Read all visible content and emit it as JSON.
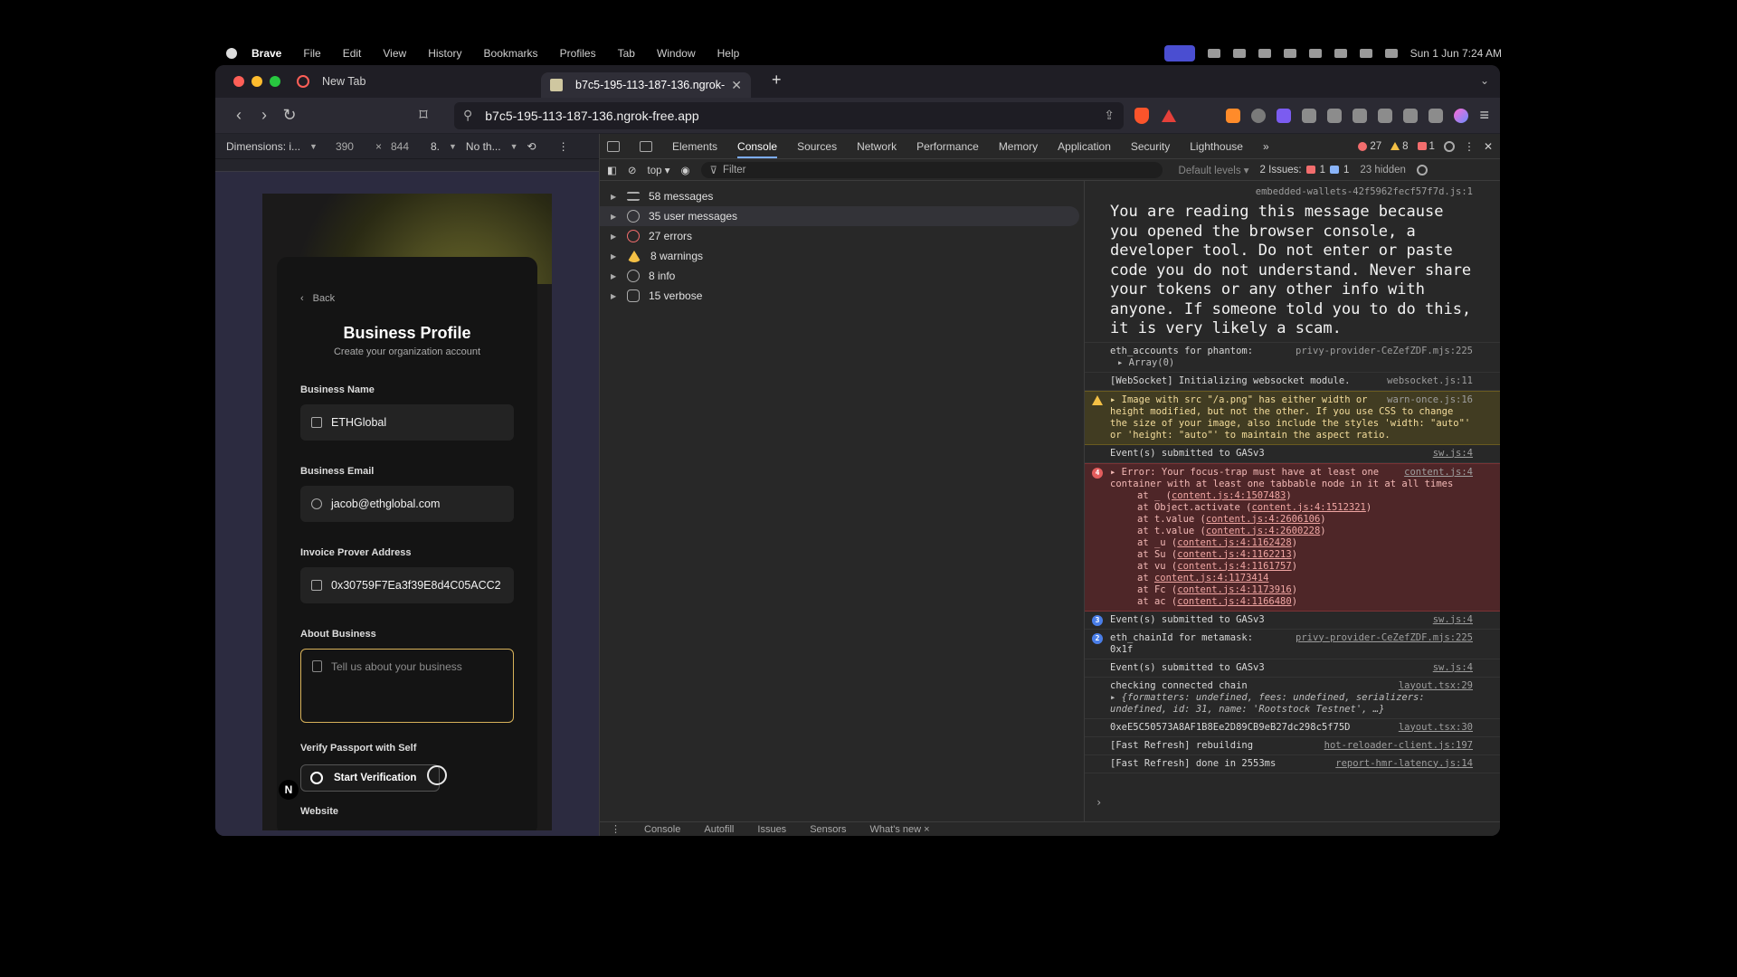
{
  "menubar": {
    "app": "Brave",
    "items": [
      "File",
      "Edit",
      "View",
      "History",
      "Bookmarks",
      "Profiles",
      "Tab",
      "Window",
      "Help"
    ],
    "clock": "Sun 1 Jun 7:24 AM"
  },
  "browser": {
    "tabs": [
      {
        "title": "New Tab"
      },
      {
        "title": "b7c5-195-113-187-136.ngrok-"
      }
    ],
    "url": "b7c5-195-113-187-136.ngrok-free.app"
  },
  "device_toolbar": {
    "dimensions_label": "Dimensions: i...",
    "width": "390",
    "times": "×",
    "height": "844",
    "zoom": "8.",
    "throttle": "No th..."
  },
  "app": {
    "back_label": "Back",
    "title": "Business Profile",
    "subtitle": "Create your organization account",
    "fields": {
      "business_name": {
        "label": "Business Name",
        "value": "ETHGlobal"
      },
      "business_email": {
        "label": "Business Email",
        "value": "jacob@ethglobal.com"
      },
      "prover_address": {
        "label": "Invoice Prover Address",
        "value": "0x30759F7Ea3f39E8d4C05ACC2"
      },
      "about": {
        "label": "About Business",
        "placeholder": "Tell us about your business"
      }
    },
    "verify_label": "Verify Passport with Self",
    "verify_button": "Start Verification",
    "website_label": "Website",
    "fab_label": "N"
  },
  "devtools": {
    "tabs": [
      "Elements",
      "Console",
      "Sources",
      "Network",
      "Performance",
      "Memory",
      "Application",
      "Security",
      "Lighthouse"
    ],
    "active_tab": "Console",
    "more_tabs": "»",
    "counts": {
      "errors": "27",
      "warnings": "8",
      "issues": "1"
    },
    "filterbar": {
      "context": "top",
      "filter_placeholder": "Filter",
      "levels": "Default levels",
      "issues_label": "2 Issues:",
      "issues_err": "1",
      "issues_info": "1",
      "hidden": "23 hidden"
    },
    "sidebar": [
      {
        "label": "58 messages",
        "icon": "list-icon"
      },
      {
        "label": "35 user messages",
        "icon": "user-icon"
      },
      {
        "label": "27 errors",
        "icon": "error-icon"
      },
      {
        "label": "8 warnings",
        "icon": "warning-icon"
      },
      {
        "label": "8 info",
        "icon": "info-icon"
      },
      {
        "label": "15 verbose",
        "icon": "bug-icon"
      }
    ],
    "console": {
      "msg0_src": "embedded-wallets-42f5962fecf57f7d.js:1",
      "selfxss": "You are reading this message because you opened the browser console, a developer tool. Do not enter or paste code you do not understand. Never share your tokens or any other info with anyone. If someone told you to do this, it is very likely a scam.",
      "msg1_text": "eth_accounts for phantom:",
      "msg1_src": "privy-provider-CeZefZDF.mjs:225",
      "msg1_sub": "Array(0)",
      "msg2_text": "[WebSocket] Initializing websocket module.",
      "msg2_src": "websocket.js:11",
      "warn_text": "Image with src \"/a.png\" has either width or height modified, but not the other. If you use CSS to change the size of your image, also include the styles 'width: \"auto\"' or 'height: \"auto\"' to maintain the aspect ratio.",
      "warn_src": "warn-once.js:16",
      "msg3_text": "Event(s) submitted to GASv3",
      "msg3_src": "sw.js:4",
      "err_count": "4",
      "err_text": "Error: Your focus-trap must have at least one container with at least one tabbable node in it at all times",
      "err_src": "content.js:4",
      "stack": [
        {
          "fn": "at _ (",
          "loc": "content.js:4:1507483",
          "end": ")"
        },
        {
          "fn": "at Object.activate (",
          "loc": "content.js:4:1512321",
          "end": ")"
        },
        {
          "fn": "at t.value (",
          "loc": "content.js:4:2606106",
          "end": ")"
        },
        {
          "fn": "at t.value (",
          "loc": "content.js:4:2600228",
          "end": ")"
        },
        {
          "fn": "at _u (",
          "loc": "content.js:4:1162428",
          "end": ")"
        },
        {
          "fn": "at Su (",
          "loc": "content.js:4:1162213",
          "end": ")"
        },
        {
          "fn": "at vu (",
          "loc": "content.js:4:1161757",
          "end": ")"
        },
        {
          "fn": "at ",
          "loc": "content.js:4:1173414",
          "end": ""
        },
        {
          "fn": "at Fc (",
          "loc": "content.js:4:1173916",
          "end": ")"
        },
        {
          "fn": "at ac (",
          "loc": "content.js:4:1166480",
          "end": ")"
        }
      ],
      "msg4_count": "3",
      "msg4_text": "Event(s) submitted to GASv3",
      "msg4_src": "sw.js:4",
      "msg5_count": "2",
      "msg5_text": "eth_chainId for metamask:",
      "msg5_sub": "0x1f",
      "msg5_src": "privy-provider-CeZefZDF.mjs:225",
      "msg6_text": "Event(s) submitted to GASv3",
      "msg6_src": "sw.js:4",
      "msg7_text": "checking connected chain",
      "msg7_src": "layout.tsx:29",
      "msg7_obj": "{formatters: undefined, fees: undefined, serializers: undefined, id: 31, name: 'Rootstock Testnet', …}",
      "msg8_text": "0xeE5C50573A8AF1B8Ee2D89CB9eB27dc298c5f75D",
      "msg8_src": "layout.tsx:30",
      "msg9_text": "[Fast Refresh] rebuilding",
      "msg9_src": "hot-reloader-client.js:197",
      "msg10_text": "[Fast Refresh] done in 2553ms",
      "msg10_src": "report-hmr-latency.js:14",
      "prompt": "›"
    },
    "drawer_tabs": [
      "Console",
      "Autofill",
      "Issues",
      "Sensors",
      "What's new ×"
    ]
  }
}
